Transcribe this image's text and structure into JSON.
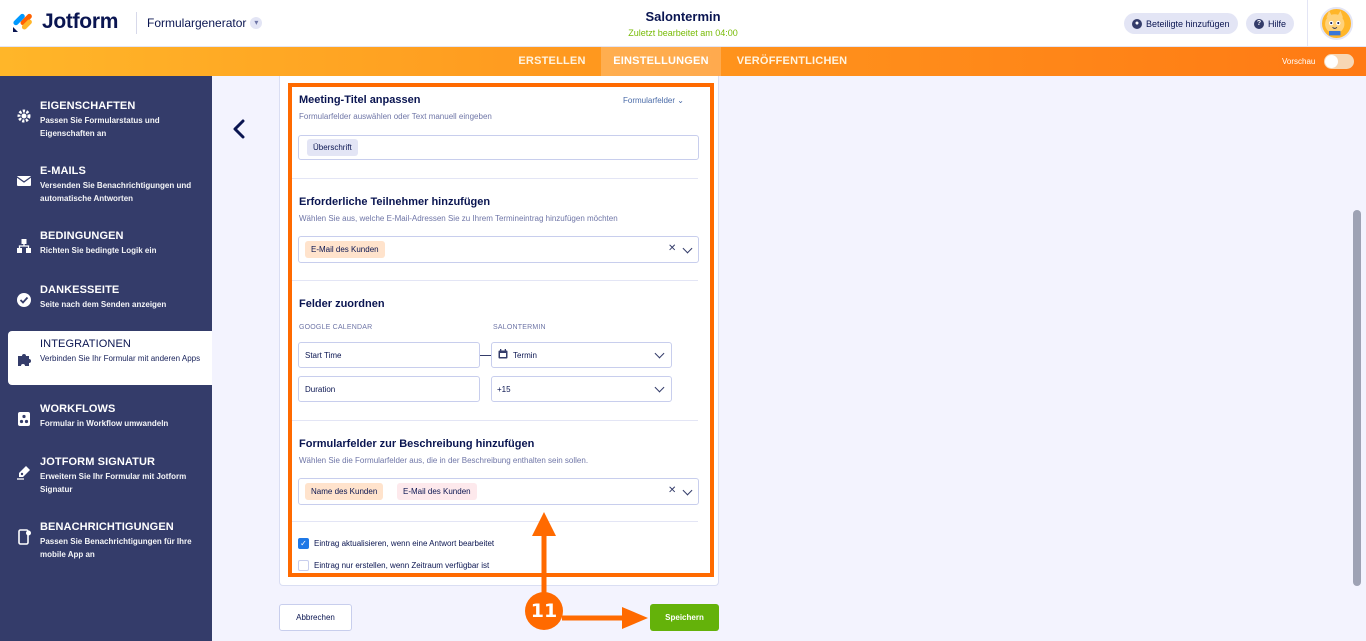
{
  "header": {
    "logo_text": "Jotform",
    "app_section": "Formulargenerator",
    "form_title": "Salontermin",
    "last_edited": "Zuletzt bearbeitet am 04:00",
    "invite_label": "Beteiligte hinzufügen",
    "help_label": "Hilfe"
  },
  "nav": {
    "tabs": [
      {
        "label": "ERSTELLEN"
      },
      {
        "label": "EINSTELLUNGEN"
      },
      {
        "label": "VERÖFFENTLICHEN"
      }
    ],
    "preview_label": "Vorschau"
  },
  "sidebar": {
    "items": [
      {
        "title": "EIGENSCHAFTEN",
        "desc": "Passen Sie Formularstatus und Eigenschaften an"
      },
      {
        "title": "E-MAILS",
        "desc": "Versenden Sie Benachrichtigungen und automatische Antworten"
      },
      {
        "title": "BEDINGUNGEN",
        "desc": "Richten Sie bedingte Logik ein"
      },
      {
        "title": "DANKESSEITE",
        "desc": "Seite nach dem Senden anzeigen"
      },
      {
        "title": "INTEGRATIONEN",
        "desc": "Verbinden Sie Ihr Formular mit anderen Apps"
      },
      {
        "title": "WORKFLOWS",
        "desc": "Formular in Workflow umwandeln"
      },
      {
        "title": "JOTFORM SIGNATUR",
        "desc": "Erweitern Sie Ihr Formular mit Jotform Signatur"
      },
      {
        "title": "BENACHRICHTIGUNGEN",
        "desc": "Passen Sie Benachrichtigungen für Ihre mobile App an"
      }
    ]
  },
  "meeting_title": {
    "title": "Meeting-Titel anpassen",
    "desc": "Formularfelder auswählen oder Text manuell eingeben",
    "form_fields_link": "Formularfelder",
    "chip": "Überschrift"
  },
  "attendees": {
    "title": "Erforderliche Teilnehmer hinzufügen",
    "desc": "Wählen Sie aus, welche E-Mail-Adressen Sie zu Ihrem Termineintrag hinzufügen möchten",
    "chip": "E-Mail des Kunden"
  },
  "mapping": {
    "title": "Felder zuordnen",
    "col_left": "GOOGLE CALENDAR",
    "col_right": "SALONTERMIN",
    "rows": [
      {
        "left": "Start Time",
        "right": "Termin"
      },
      {
        "left": "Duration",
        "right": "+15"
      }
    ]
  },
  "description": {
    "title": "Formularfelder zur Beschreibung hinzufügen",
    "desc": "Wählen Sie die Formularfelder aus, die in der Beschreibung enthalten sein sollen.",
    "chips": [
      "Name des Kunden",
      "E-Mail des Kunden"
    ]
  },
  "options": {
    "update_entry": "Eintrag aktualisieren, wenn eine Antwort bearbeitet",
    "only_if_free": "Eintrag nur erstellen, wenn Zeitraum verfügbar ist"
  },
  "buttons": {
    "cancel": "Abbrechen",
    "save": "Speichern"
  },
  "annotation": {
    "step_number": "11",
    "color": "#ff6a00"
  },
  "colors": {
    "sidebar_bg": "#343c6a",
    "nav_gradient_start": "#ffb629",
    "nav_gradient_end": "#ff7a14",
    "save_green": "#64b20a",
    "accent_orange": "#ff6a00"
  }
}
